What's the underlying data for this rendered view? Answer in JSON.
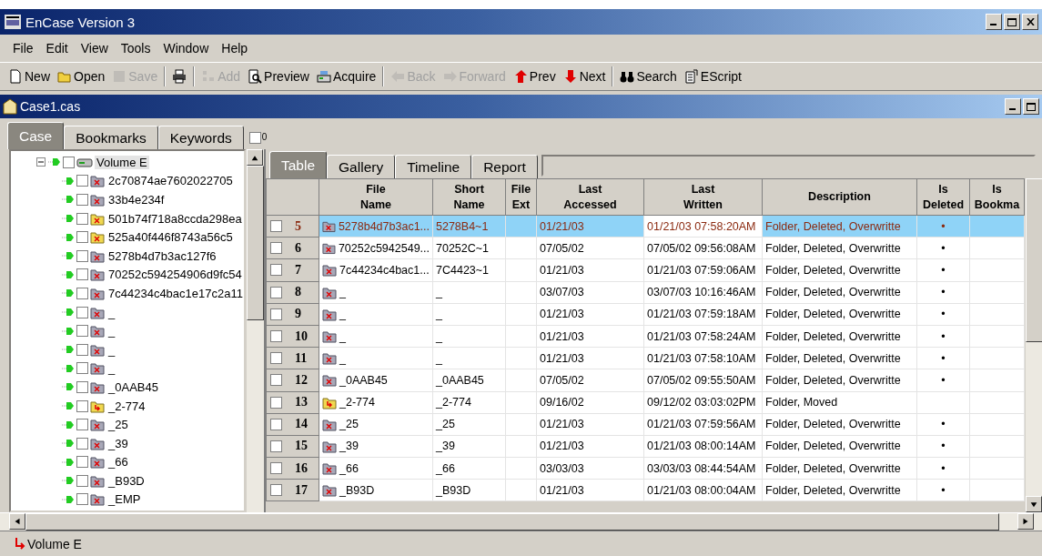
{
  "window": {
    "title": "EnCase Version 3"
  },
  "menu": [
    "File",
    "Edit",
    "View",
    "Tools",
    "Window",
    "Help"
  ],
  "toolbar": [
    {
      "kind": "new",
      "label": "New",
      "disabled": false
    },
    {
      "kind": "open",
      "label": "Open",
      "disabled": false
    },
    {
      "kind": "save",
      "label": "Save",
      "disabled": true
    },
    {
      "kind": "separator"
    },
    {
      "kind": "print",
      "disabled": false
    },
    {
      "kind": "separator"
    },
    {
      "kind": "add",
      "label": "Add",
      "disabled": true
    },
    {
      "kind": "preview",
      "label": "Preview",
      "disabled": false
    },
    {
      "kind": "acquire",
      "label": "Acquire",
      "disabled": false
    },
    {
      "kind": "separator"
    },
    {
      "kind": "back",
      "label": "Back",
      "disabled": true
    },
    {
      "kind": "forward",
      "label": "Forward",
      "disabled": true
    },
    {
      "kind": "prev",
      "label": "Prev",
      "disabled": false
    },
    {
      "kind": "next",
      "label": "Next",
      "disabled": false
    },
    {
      "kind": "separator"
    },
    {
      "kind": "search",
      "label": "Search",
      "disabled": false
    },
    {
      "kind": "escript",
      "label": "EScript",
      "disabled": false
    }
  ],
  "case_window": {
    "title": "Case1.cas"
  },
  "left_tabs": [
    {
      "label": "Case",
      "selected": true
    },
    {
      "label": "Bookmarks",
      "selected": false
    },
    {
      "label": "Keywords",
      "selected": false
    }
  ],
  "bookmark_count": {
    "checked": false,
    "count": "0"
  },
  "tree": {
    "label": "Volume E",
    "checked": false,
    "expanded": true,
    "selected": true,
    "children": [
      {
        "label": "2c70874ae7602022705",
        "kind": "deleted",
        "checked": false
      },
      {
        "label": "33b4e234f",
        "kind": "deleted",
        "checked": false
      },
      {
        "label": "501b74f718a8ccda298ea",
        "kind": "deleted-file",
        "checked": false
      },
      {
        "label": "525a40f446f8743a56c5",
        "kind": "deleted-file",
        "checked": false
      },
      {
        "label": "5278b4d7b3ac127f6",
        "kind": "deleted",
        "checked": false
      },
      {
        "label": "70252c594254906d9fc54",
        "kind": "deleted",
        "checked": false
      },
      {
        "label": "7c44234c4bac1e17c2a11",
        "kind": "deleted",
        "checked": false
      },
      {
        "label": "_",
        "kind": "deleted",
        "checked": false
      },
      {
        "label": "_",
        "kind": "deleted",
        "checked": false
      },
      {
        "label": "_",
        "kind": "deleted",
        "checked": false
      },
      {
        "label": "_",
        "kind": "deleted",
        "checked": false
      },
      {
        "label": "_0AAB45",
        "kind": "deleted",
        "checked": false
      },
      {
        "label": "_2-774",
        "kind": "moved",
        "checked": false
      },
      {
        "label": "_25",
        "kind": "deleted",
        "checked": false
      },
      {
        "label": "_39",
        "kind": "deleted",
        "checked": false
      },
      {
        "label": "_66",
        "kind": "deleted",
        "checked": false
      },
      {
        "label": "_B93D",
        "kind": "deleted",
        "checked": false
      },
      {
        "label": "_EMP",
        "kind": "deleted",
        "checked": false
      }
    ]
  },
  "right_tabs": [
    {
      "label": "Table",
      "selected": true
    },
    {
      "label": "Gallery",
      "selected": false
    },
    {
      "label": "Timeline",
      "selected": false
    },
    {
      "label": "Report",
      "selected": false
    }
  ],
  "table": {
    "columns": [
      [
        "File",
        "Name"
      ],
      [
        "Short",
        "Name"
      ],
      [
        "File",
        "Ext"
      ],
      [
        "Last",
        "Accessed"
      ],
      [
        "Last",
        "Written"
      ],
      [
        "Description"
      ],
      [
        "Is",
        "Deleted"
      ],
      [
        "Is",
        "Bookma"
      ]
    ],
    "rows": [
      {
        "index": "5",
        "kind": "deleted",
        "selected": true,
        "checked": false,
        "file_name": "5278b4d7b3ac1...",
        "short_name": "5278B4~1",
        "accessed": "01/21/03",
        "written": "01/21/03 07:58:20AM",
        "description": "Folder, Deleted, Overwritte",
        "is_deleted": "•"
      },
      {
        "index": "6",
        "kind": "deleted",
        "selected": false,
        "checked": false,
        "file_name": "70252c5942549...",
        "short_name": "70252C~1",
        "accessed": "07/05/02",
        "written": "07/05/02 09:56:08AM",
        "description": "Folder, Deleted, Overwritte",
        "is_deleted": "•"
      },
      {
        "index": "7",
        "kind": "deleted",
        "selected": false,
        "checked": false,
        "file_name": "7c44234c4bac1...",
        "short_name": "7C4423~1",
        "accessed": "01/21/03",
        "written": "01/21/03 07:59:06AM",
        "description": "Folder, Deleted, Overwritte",
        "is_deleted": "•"
      },
      {
        "index": "8",
        "kind": "deleted",
        "selected": false,
        "checked": false,
        "file_name": "_",
        "short_name": "_",
        "accessed": "03/07/03",
        "written": "03/07/03 10:16:46AM",
        "description": "Folder, Deleted, Overwritte",
        "is_deleted": "•"
      },
      {
        "index": "9",
        "kind": "deleted",
        "selected": false,
        "checked": false,
        "file_name": "_",
        "short_name": "_",
        "accessed": "01/21/03",
        "written": "01/21/03 07:59:18AM",
        "description": "Folder, Deleted, Overwritte",
        "is_deleted": "•"
      },
      {
        "index": "10",
        "kind": "deleted",
        "selected": false,
        "checked": false,
        "file_name": "_",
        "short_name": "_",
        "accessed": "01/21/03",
        "written": "01/21/03 07:58:24AM",
        "description": "Folder, Deleted, Overwritte",
        "is_deleted": "•"
      },
      {
        "index": "11",
        "kind": "deleted",
        "selected": false,
        "checked": false,
        "file_name": "_",
        "short_name": "_",
        "accessed": "01/21/03",
        "written": "01/21/03 07:58:10AM",
        "description": "Folder, Deleted, Overwritte",
        "is_deleted": "•"
      },
      {
        "index": "12",
        "kind": "deleted",
        "selected": false,
        "checked": false,
        "file_name": "_0AAB45",
        "short_name": "_0AAB45",
        "accessed": "07/05/02",
        "written": "07/05/02 09:55:50AM",
        "description": "Folder, Deleted, Overwritte",
        "is_deleted": "•"
      },
      {
        "index": "13",
        "kind": "moved",
        "selected": false,
        "checked": false,
        "file_name": "_2-774",
        "short_name": "_2-774",
        "accessed": "09/16/02",
        "written": "09/12/02 03:03:02PM",
        "description": "Folder, Moved"
      },
      {
        "index": "14",
        "kind": "deleted",
        "selected": false,
        "checked": false,
        "file_name": "_25",
        "short_name": "_25",
        "accessed": "01/21/03",
        "written": "01/21/03 07:59:56AM",
        "description": "Folder, Deleted, Overwritte",
        "is_deleted": "•"
      },
      {
        "index": "15",
        "kind": "deleted",
        "selected": false,
        "checked": false,
        "file_name": "_39",
        "short_name": "_39",
        "accessed": "01/21/03",
        "written": "01/21/03 08:00:14AM",
        "description": "Folder, Deleted, Overwritte",
        "is_deleted": "•"
      },
      {
        "index": "16",
        "kind": "deleted",
        "selected": false,
        "checked": false,
        "file_name": "_66",
        "short_name": "_66",
        "accessed": "03/03/03",
        "written": "03/03/03 08:44:54AM",
        "description": "Folder, Deleted, Overwritte",
        "is_deleted": "•"
      },
      {
        "index": "17",
        "kind": "deleted",
        "selected": false,
        "checked": false,
        "file_name": "_B93D",
        "short_name": "_B93D",
        "accessed": "01/21/03",
        "written": "01/21/03 08:00:04AM",
        "description": "Folder, Deleted, Overwritte",
        "is_deleted": "•"
      }
    ]
  },
  "status_bar": {
    "path": "Volume E"
  }
}
